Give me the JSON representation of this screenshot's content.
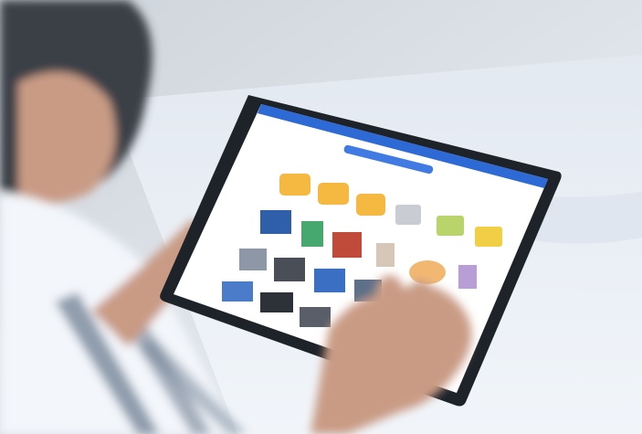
{
  "scene": {
    "colors": {
      "wall": "#d8dde3",
      "bed": "#e8eef7",
      "hair": "#3a3f46",
      "skin": "#c99b85",
      "shirt": "#f3f6fb",
      "shirt_stripe": "#6f7f93",
      "tablet_bezel": "#1e232a",
      "tablet_screen": "#ffffff",
      "header_blue": "#2d6ad6",
      "folder": "#f5b942"
    },
    "tablet_app": {
      "icons": [
        "folder-icon",
        "folder-icon",
        "folder-icon",
        "gallery-icon",
        "gallery-icon",
        "gallery-icon",
        "photo-thumbnail",
        "photo-thumbnail",
        "photo-thumbnail",
        "photo-thumbnail",
        "photo-thumbnail",
        "photo-thumbnail",
        "photo-thumbnail",
        "photo-thumbnail",
        "photo-thumbnail",
        "photo-thumbnail",
        "photo-thumbnail",
        "photo-thumbnail"
      ]
    }
  }
}
